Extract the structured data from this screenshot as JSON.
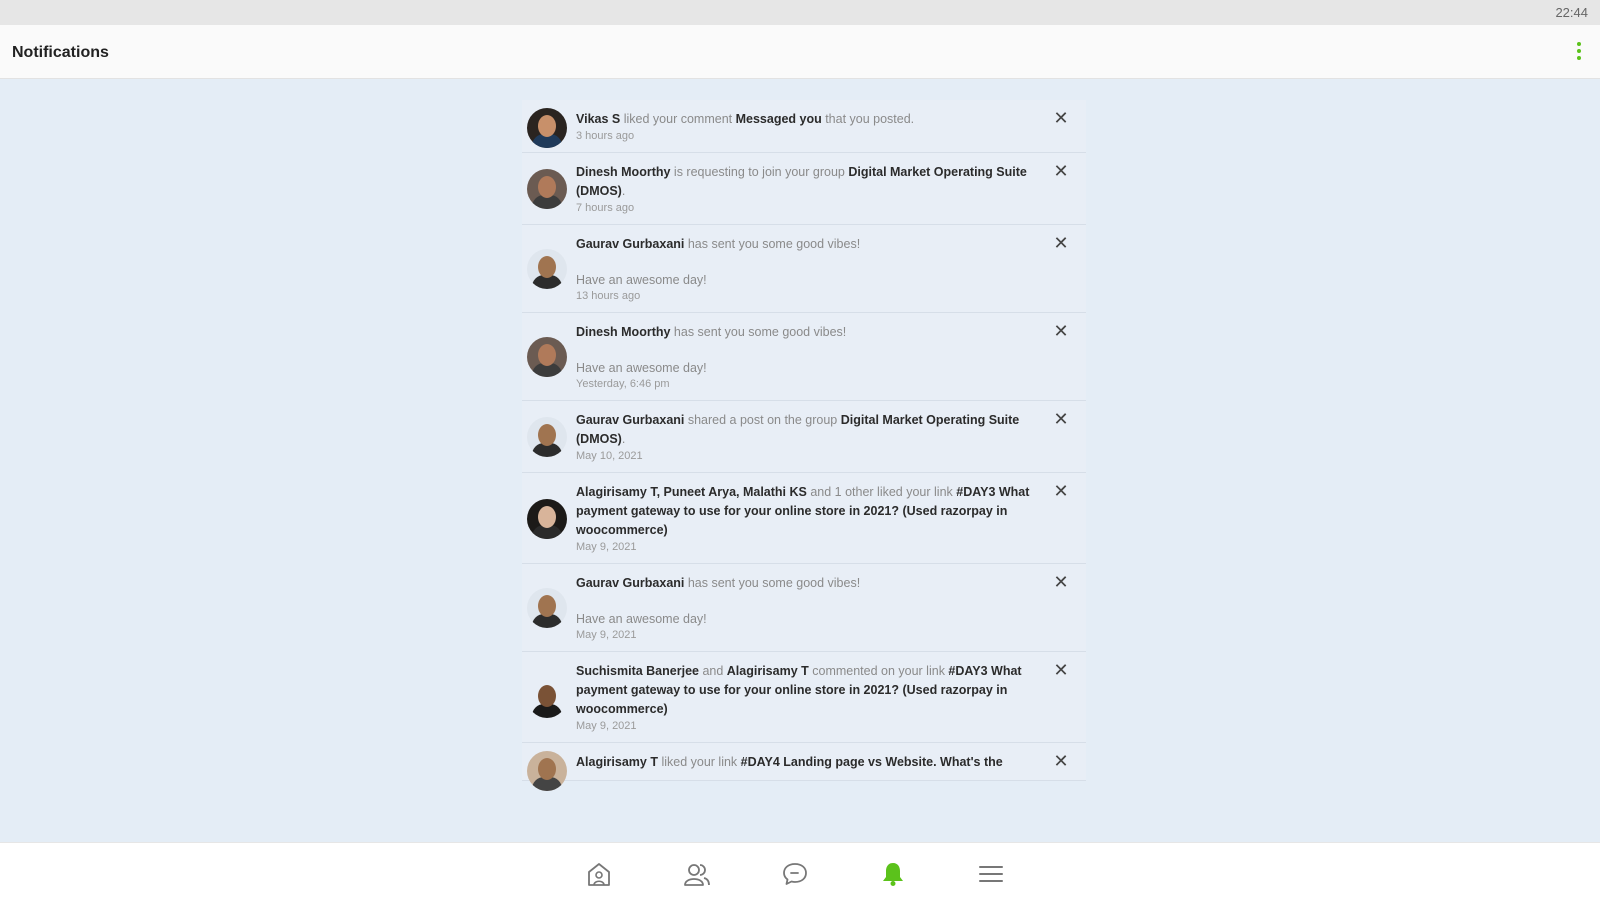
{
  "status": {
    "time": "22:44"
  },
  "header": {
    "title": "Notifications",
    "menu_icon": "more-vert-icon"
  },
  "colors": {
    "accent": "#5bc21b",
    "background": "#e4edf6"
  },
  "notifications": [
    {
      "parts": [
        {
          "text": "Vikas S",
          "bold": true
        },
        {
          "text": " liked your comment ",
          "bold": false
        },
        {
          "text": "Messaged you",
          "bold": true
        },
        {
          "text": " that you posted.",
          "bold": false
        }
      ],
      "message": "",
      "time": "3 hours ago",
      "close_icon": "close-icon"
    },
    {
      "parts": [
        {
          "text": "Dinesh Moorthy",
          "bold": true
        },
        {
          "text": " is requesting to join your group ",
          "bold": false
        },
        {
          "text": "Digital Market Operating Suite (DMOS)",
          "bold": true
        },
        {
          "text": ".",
          "bold": false
        }
      ],
      "message": "",
      "time": "7 hours ago",
      "close_icon": "close-icon"
    },
    {
      "parts": [
        {
          "text": "Gaurav Gurbaxani",
          "bold": true
        },
        {
          "text": " has sent you some good vibes!",
          "bold": false
        }
      ],
      "message": "Have an awesome day!",
      "time": "13 hours ago",
      "close_icon": "close-icon"
    },
    {
      "parts": [
        {
          "text": "Dinesh Moorthy",
          "bold": true
        },
        {
          "text": " has sent you some good vibes!",
          "bold": false
        }
      ],
      "message": "Have an awesome day!",
      "time": "Yesterday, 6:46 pm",
      "close_icon": "close-icon"
    },
    {
      "parts": [
        {
          "text": "Gaurav Gurbaxani",
          "bold": true
        },
        {
          "text": " shared a post on the group ",
          "bold": false
        },
        {
          "text": "Digital Market Operating Suite (DMOS)",
          "bold": true
        },
        {
          "text": ".",
          "bold": false
        }
      ],
      "message": "",
      "time": "May 10, 2021",
      "close_icon": "close-icon"
    },
    {
      "parts": [
        {
          "text": "Alagirisamy T, Puneet Arya, Malathi KS",
          "bold": true
        },
        {
          "text": " and 1 other liked your link ",
          "bold": false
        },
        {
          "text": "#DAY3 What payment gateway to use for your online store in 2021? (Used razorpay in woocommerce)",
          "bold": true
        }
      ],
      "message": "",
      "time": "May 9, 2021",
      "close_icon": "close-icon"
    },
    {
      "parts": [
        {
          "text": "Gaurav Gurbaxani",
          "bold": true
        },
        {
          "text": " has sent you some good vibes!",
          "bold": false
        }
      ],
      "message": "Have an awesome day!",
      "time": "May 9, 2021",
      "close_icon": "close-icon"
    },
    {
      "parts": [
        {
          "text": "Suchismita Banerjee",
          "bold": true
        },
        {
          "text": " and ",
          "bold": false
        },
        {
          "text": "Alagirisamy T",
          "bold": true
        },
        {
          "text": " commented on your link ",
          "bold": false
        },
        {
          "text": "#DAY3 What payment gateway to use for your online store in 2021? (Used razorpay in woocommerce)",
          "bold": true
        }
      ],
      "message": "",
      "time": "May 9, 2021",
      "close_icon": "close-icon"
    },
    {
      "parts": [
        {
          "text": "Alagirisamy T",
          "bold": true
        },
        {
          "text": " liked your link ",
          "bold": false
        },
        {
          "text": "#DAY4 Landing page vs Website. What's the",
          "bold": true
        }
      ],
      "message": "",
      "time": "",
      "close_icon": "close-icon"
    }
  ],
  "bottom_nav": [
    {
      "icon": "home-icon",
      "active": false
    },
    {
      "icon": "members-icon",
      "active": false
    },
    {
      "icon": "messages-icon",
      "active": false
    },
    {
      "icon": "bell-icon",
      "active": true
    },
    {
      "icon": "menu-icon",
      "active": false
    }
  ]
}
